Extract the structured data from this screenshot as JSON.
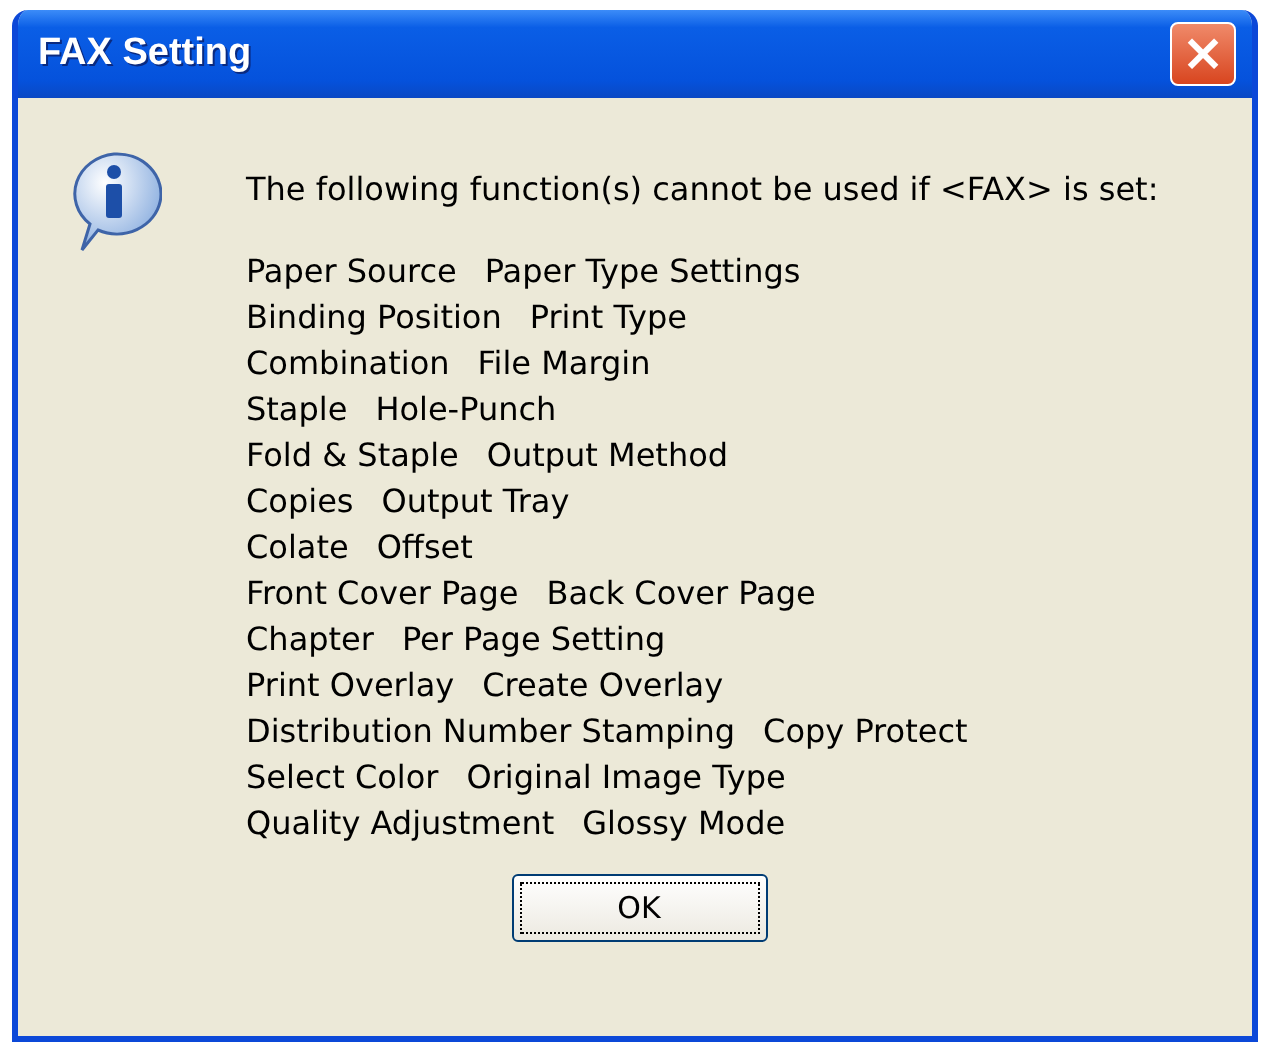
{
  "window": {
    "title": "FAX Setting",
    "close": "×"
  },
  "message": "The following function(s) cannot be used if <FAX> is set:",
  "functions": [
    [
      "Paper Source",
      "Paper Type Settings"
    ],
    [
      "Binding Position",
      "Print Type"
    ],
    [
      "Combination",
      "File Margin"
    ],
    [
      "Staple",
      "Hole-Punch"
    ],
    [
      "Fold & Staple",
      "Output Method"
    ],
    [
      "Copies",
      "Output Tray"
    ],
    [
      "Colate",
      "Offset"
    ],
    [
      "Front Cover Page",
      "Back Cover Page"
    ],
    [
      "Chapter",
      "Per Page Setting"
    ],
    [
      "Print Overlay",
      "Create Overlay"
    ],
    [
      "Distribution Number Stamping",
      "Copy Protect"
    ],
    [
      "Select Color",
      "Original Image Type"
    ],
    [
      "Quality Adjustment",
      "Glossy Mode"
    ]
  ],
  "buttons": [
    "OK"
  ]
}
